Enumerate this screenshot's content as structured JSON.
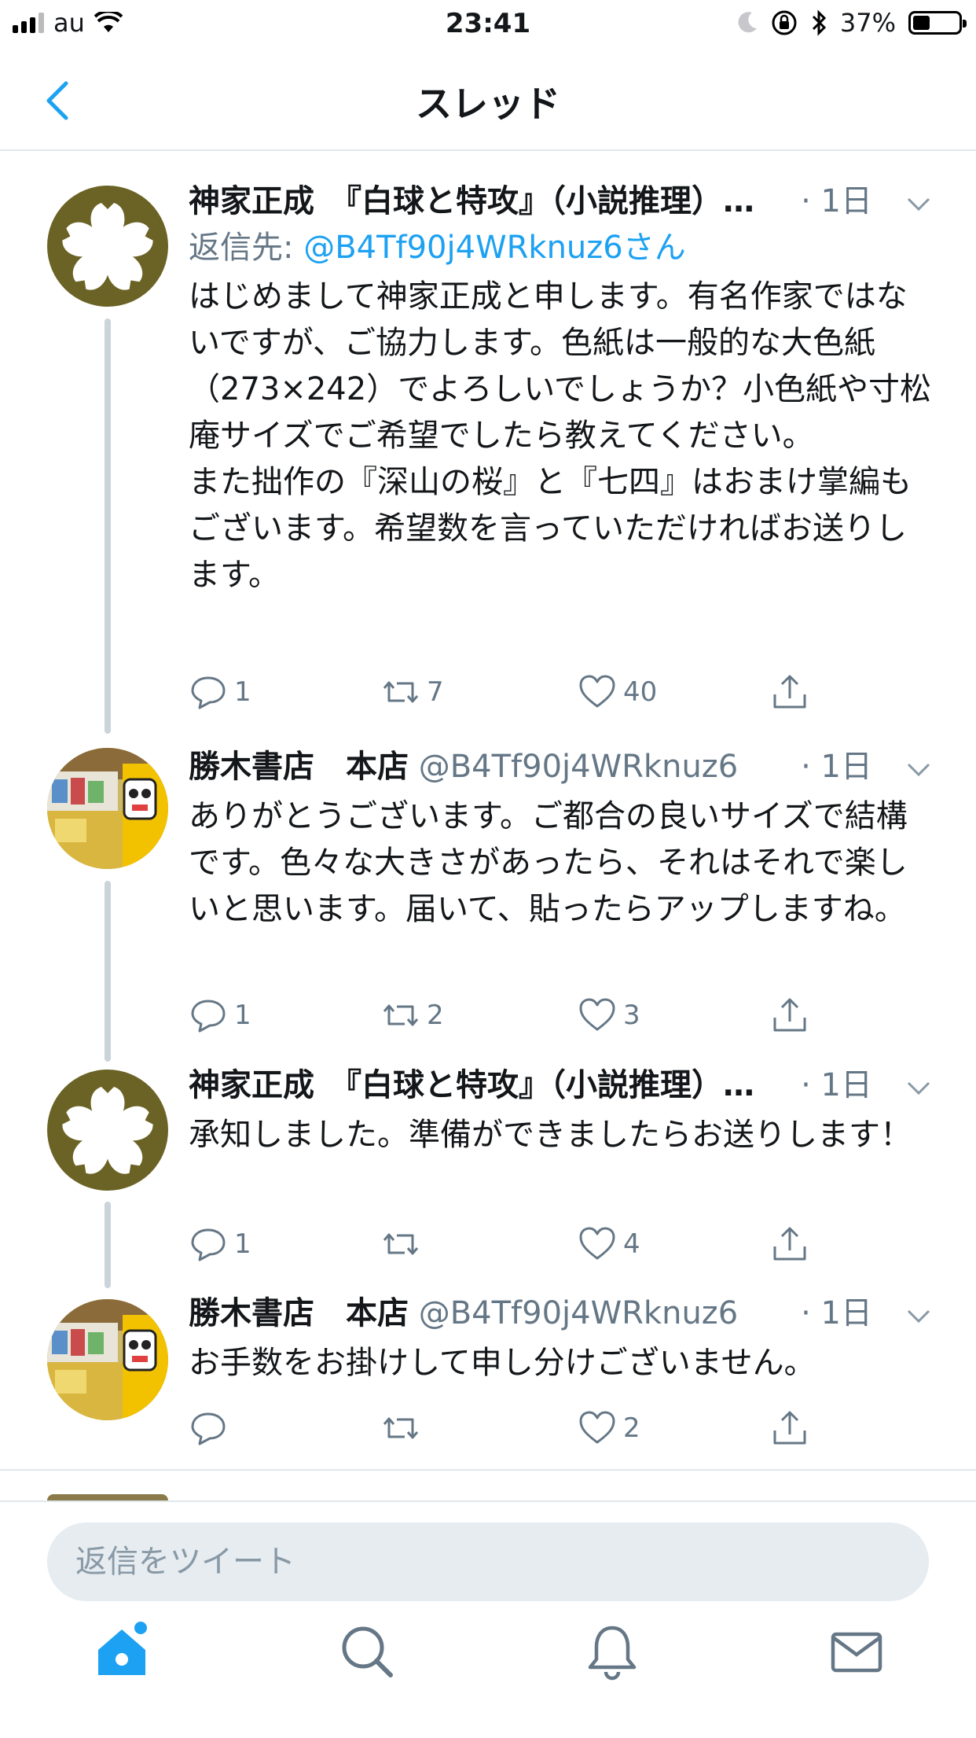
{
  "status_bar": {
    "carrier": "au",
    "time": "23:41",
    "battery": "37%",
    "battery_level": 0.37
  },
  "nav": {
    "title": "スレッド",
    "back_icon": "chevron-left-icon"
  },
  "tweets": [
    {
      "name": "神家正成　『白球と特攻』（小説推理）…",
      "handle": "",
      "time": "· 1日",
      "reply_to_label": "返信先: ",
      "reply_to_handle": "@B4Tf90j4WRknuz6さん",
      "text": "はじめまして神家正成と申します。有名作家ではないですが、ご協力します。色紙は一般的な大色紙（273×242）でよろしいでしょうか？小色紙や寸松庵サイズでご希望でしたら教えてください。\nまた拙作の『深山の桜』と『七四』はおまけ掌編もございます。希望数を言っていただければお送りします。",
      "replies": "1",
      "retweets": "7",
      "likes": "40"
    },
    {
      "name": "勝木書店　本店",
      "handle": "@B4Tf90j4WRknuz6",
      "time": "· 1日",
      "text": "ありがとうございます。ご都合の良いサイズで結構です。色々な大きさがあったら、それはそれで楽しいと思います。届いて、貼ったらアップしますね。",
      "replies": "1",
      "retweets": "2",
      "likes": "3"
    },
    {
      "name": "神家正成　『白球と特攻』（小説推理）…",
      "handle": "",
      "time": "· 1日",
      "text": "承知しました。準備ができましたらお送りします！",
      "replies": "1",
      "retweets": "",
      "likes": "4"
    },
    {
      "name": "勝木書店　本店",
      "handle": "@B4Tf90j4WRknuz6",
      "time": "· 1日",
      "text": "お手数をお掛けして申し分けございません。",
      "replies": "",
      "retweets": "",
      "likes": "2"
    }
  ],
  "reply_bar": {
    "placeholder": "返信をツイート"
  },
  "tab_bar": {
    "items": [
      "home-icon",
      "search-icon",
      "bell-icon",
      "mail-icon"
    ],
    "active_color": "#1da1f2",
    "inactive_color": "#657786"
  }
}
